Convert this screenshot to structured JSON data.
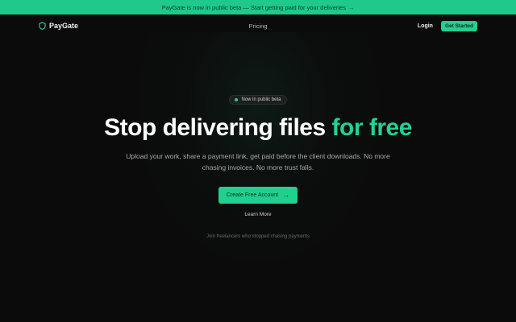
{
  "announcement": {
    "text": "PayGate is now in public beta — Start getting paid for your deliveries",
    "arrow": "→"
  },
  "nav": {
    "brand": "PayGate",
    "links": [
      "Pricing"
    ],
    "login": "Login",
    "cta": "Get Started"
  },
  "hero": {
    "badge": "Now in public beta",
    "headline_main": "Stop delivering files ",
    "headline_accent": "for free",
    "subheadline": "Upload your work, share a payment link, get paid before the client downloads. No more chasing invoices. No more trust falls.",
    "cta": "Create Free Account",
    "cta_arrow": "→",
    "secondary": "Learn More",
    "social_proof": "Join freelancers who stopped chasing payments"
  },
  "colors": {
    "accent": "#1fd08f",
    "background": "#0b0b0b"
  }
}
